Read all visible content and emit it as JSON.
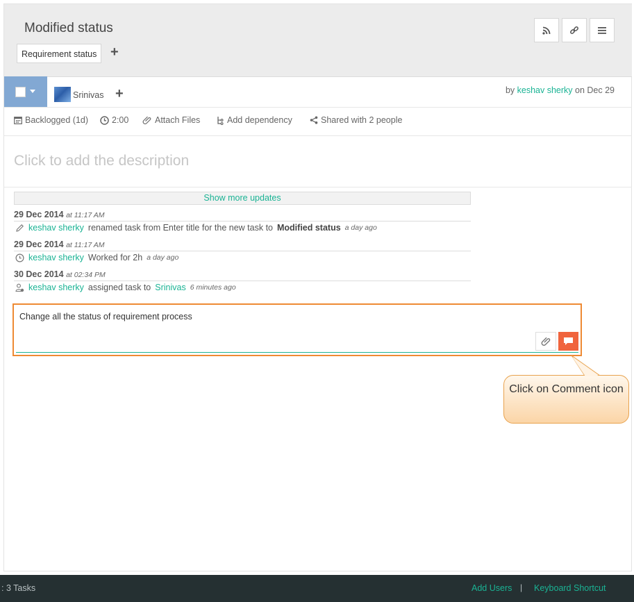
{
  "header": {
    "title": "Modified status",
    "tag_label": "Requirement status",
    "add_tag": "+"
  },
  "task": {
    "assignee": "Srinivas",
    "add_assignee": "+",
    "by_prefix": "by",
    "author": "keshav sherky",
    "on_text": "on Dec 29"
  },
  "meta": {
    "backlogged": "Backlogged (1d)",
    "time": "2:00",
    "attach": "Attach Files",
    "dependency": "Add dependency",
    "shared": "Shared with 2 people"
  },
  "description_placeholder": "Click to add the description",
  "updates": {
    "show_more": "Show more updates",
    "items": [
      {
        "date": "29 Dec 2014",
        "time": "at 11:17 AM",
        "user": "keshav sherky",
        "action": "renamed task from Enter title for the new task to",
        "target": "Modified status",
        "ago": "a day ago"
      },
      {
        "date": "29 Dec 2014",
        "time": "at 11:17 AM",
        "user": "keshav sherky",
        "action": "Worked for 2h",
        "ago": "a day ago"
      },
      {
        "date": "30 Dec 2014",
        "time": "at 02:34 PM",
        "user": "keshav sherky",
        "action": "assigned task to",
        "target_user": "Srinivas",
        "ago": "6 minutes ago"
      }
    ]
  },
  "comment": {
    "value": "Change all the status of requirement process"
  },
  "callout": {
    "text": "Click on Comment icon"
  },
  "footer": {
    "tasks": ": 3 Tasks",
    "add_users": "Add Users",
    "separator": "|",
    "shortcut": "Keyboard Shortcut"
  },
  "colors": {
    "accent": "#1ab394",
    "comment_button": "#f0643d",
    "highlight": "#ee8a33",
    "footer_bg": "#253032"
  }
}
